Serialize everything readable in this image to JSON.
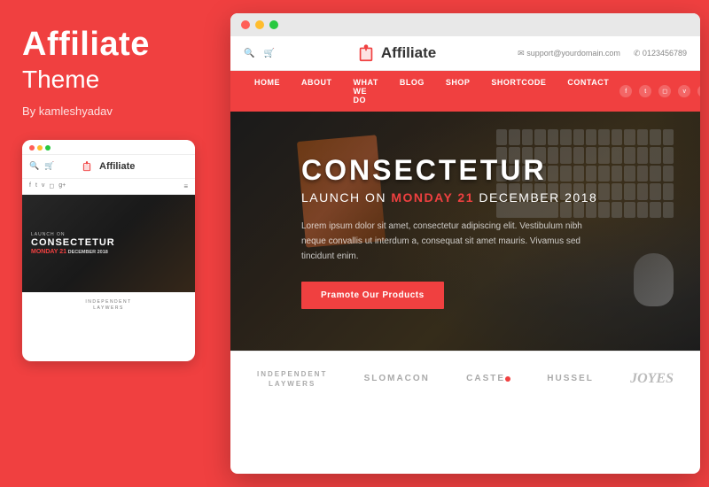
{
  "left": {
    "title": "Affiliate",
    "subtitle": "Theme",
    "author": "By kamleshyadav"
  },
  "browser": {
    "header": {
      "email": "✉ support@yourdomain.com",
      "phone": "✆ 0123456789",
      "logo_text": "Affiliate"
    },
    "nav": {
      "items": [
        "HOME",
        "ABOUT",
        "WHAT WE DO",
        "BLOG",
        "SHOP",
        "SHORTCODE",
        "CONTACT"
      ]
    },
    "hero": {
      "title": "CONSECTETUR",
      "subtitle_before": "LAUNCH ON ",
      "subtitle_highlight": "MONDAY 21",
      "subtitle_after": " DECEMBER 2018",
      "description": "Lorem ipsum dolor sit amet, consectetur adipiscing elit. Vestibulum nibh neque convallis ut interdum a, consequat sit amet mauris. Vivamus sed tincidunt enim.",
      "button_label": "Pramote Our Products"
    },
    "brands": [
      {
        "name": "INDEPENDENT\nLAWYERS",
        "script": false
      },
      {
        "name": "SLOMACON",
        "script": false
      },
      {
        "name": "CASTE",
        "dot": true,
        "script": false
      },
      {
        "name": "HUSSEL",
        "script": false
      },
      {
        "name": "Joyes",
        "script": true
      }
    ]
  },
  "mobile": {
    "logo_text": "Affiliate",
    "hero": {
      "launch_label": "LAUNCH ON",
      "title": "CONSECTETUR",
      "subtitle": "MONDAY 21",
      "subtitle_suffix": "DECEMBER 2018"
    },
    "brand": {
      "name": "INDEPENDENT\nLAWYERS"
    }
  }
}
